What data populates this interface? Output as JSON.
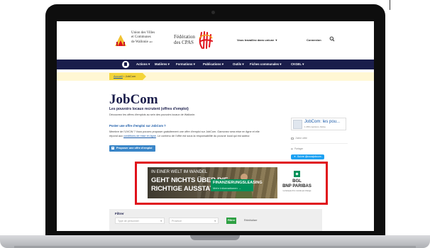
{
  "header": {
    "uvcw_logo_lines": [
      "Union des Villes",
      "et Communes",
      "de Wallonie"
    ],
    "uvcw_logo_suffix": "asbl",
    "fed_logo_lines": [
      "Fédération",
      "des CPAS"
    ],
    "newsletter_label": "Vous travaillez dans un/une",
    "login_label": "Connexion"
  },
  "nav": {
    "items": [
      "Actions",
      "Matières",
      "Formations",
      "Publications",
      "Outils",
      "Fiches communales",
      "CKGEL"
    ]
  },
  "breadcrumb": {
    "home": "Accueil",
    "separator": " › ",
    "current": "JobCom"
  },
  "main": {
    "title": "JobCom",
    "subtitle": "Les pouvoirs locaux recrutent (offres d'emploi)",
    "intro": "Découvrez les offres d'emplois au sein des pouvoirs locaux de Wallonie.",
    "question": "Poster une offre d'emploi sur JobCom ?",
    "body_line1": "Membre de l'UVCW ? Vous pouvez proposer gratuitement une offre d'emploi sur JobCom. Gamonez sera mise en ligne et elle",
    "body_line2_pre": "répond aux ",
    "body_line2_link": "conditions de mise en ligne",
    "body_line2_post": ". Le contenu de l'offre est sous la responsabilité du pouvoir local qui est auteur.",
    "post_button": "Proposer une offre d'emploi"
  },
  "sidebar": {
    "fb_page_name": "JobCom: les pou...",
    "fb_page_meta": "1 456 mentions J'aime",
    "fb_like": "J'aime cette",
    "fb_more": "Partager",
    "twitter_button": "Suivre @uvcwjobcom"
  },
  "ad": {
    "line1": "IN EINER WELT IM WANDEL",
    "line2": "GEHT NICHTS ÜBER DIE",
    "line3": "RICHTIGE AUSSTATTUNG",
    "cta_title": "FINANZIERUNGSLEASING",
    "cta_link": "Mehr Informationen",
    "cta_arrow": "→",
    "bank_l1": "BGL",
    "bank_l2": "BNP PARIBAS",
    "bank_l3": "La banque d'un monde qui change",
    "highlight_color": "#e0121b"
  },
  "filter": {
    "title": "Filtrer",
    "type_placeholder": "Type de personnel",
    "region_placeholder": "Province",
    "submit_label": "Filtrer",
    "reset_label": "Réinitialiser"
  }
}
